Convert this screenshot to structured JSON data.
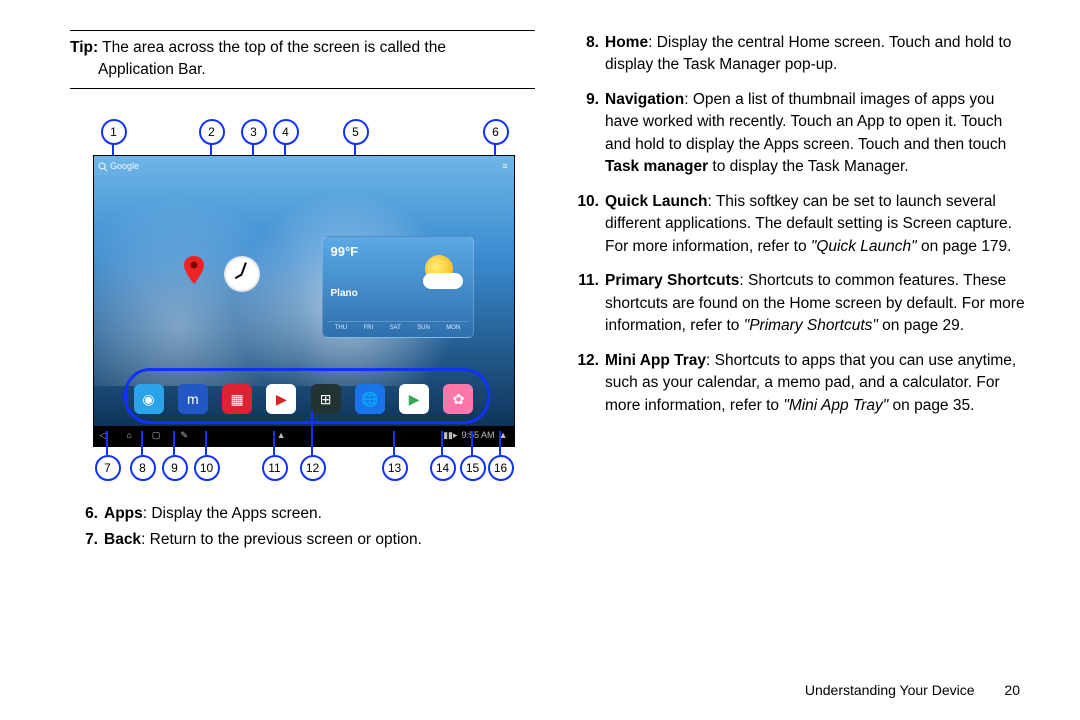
{
  "tip": {
    "label": "Tip:",
    "line1": "The area across the top of the screen is called the",
    "line2": "Application Bar."
  },
  "top_callouts": [
    "1",
    "2",
    "3",
    "4",
    "5",
    "6"
  ],
  "bottom_callouts": [
    "7",
    "8",
    "9",
    "10",
    "11",
    "12",
    "13",
    "14",
    "15",
    "16"
  ],
  "screen": {
    "search_hint": "Google",
    "weather_temp": "99°F",
    "weather_city": "Plano",
    "days": [
      "THU",
      "FRI",
      "SAT",
      "SUN",
      "MON"
    ],
    "time": "9:55 AM"
  },
  "left_list": [
    {
      "n": "6.",
      "b": "Apps",
      "t": ": Display the Apps screen."
    },
    {
      "n": "7.",
      "b": "Back",
      "t": ": Return to the previous screen or option."
    }
  ],
  "right_list": [
    {
      "n": "8.",
      "b": "Home",
      "body": ": Display the central Home screen. Touch and hold to display the Task Manager pop-up."
    },
    {
      "n": "9.",
      "b": "Navigation",
      "body": ": Open a list of thumbnail images of apps you have worked with recently. Touch an App to open it. Touch and hold to display the Apps screen. Touch and then touch ",
      "b2": "Task manager",
      "body2": " to display the Task Manager."
    },
    {
      "n": "10.",
      "b": "Quick Launch",
      "body": ": This softkey can be set to launch several different applications. The default setting is Screen capture. For more information, refer to ",
      "ref": "\"Quick Launch\"",
      "tail": " on page 179."
    },
    {
      "n": "11.",
      "b": "Primary Shortcuts",
      "body": ": Shortcuts to common features. These shortcuts are found on the Home screen by default. For more information, refer to ",
      "ref": "\"Primary Shortcuts\"",
      "tail": " on page 29."
    },
    {
      "n": "12.",
      "b": "Mini App Tray",
      "body": ": Shortcuts to apps that you can use anytime, such as your calendar, a memo pad, and a calculator. For more information, refer to ",
      "ref": "\"Mini App Tray\"",
      "tail": " on page 35."
    }
  ],
  "footer": {
    "section": "Understanding Your Device",
    "page": "20"
  }
}
